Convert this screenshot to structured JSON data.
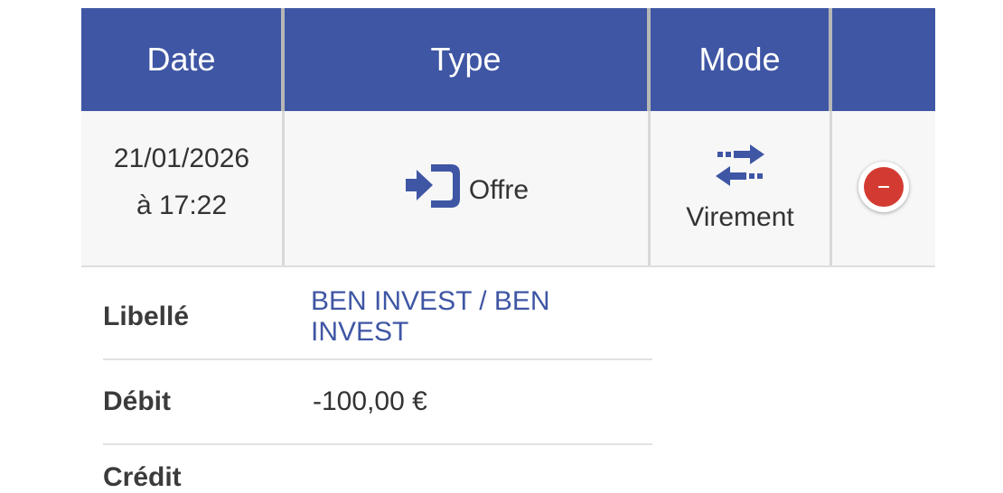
{
  "table": {
    "headers": [
      "Date",
      "Type",
      "Mode",
      ""
    ],
    "row": {
      "date_line1": "21/01/2026",
      "date_line2": "à 17:22",
      "type_label": "Offre",
      "type_icon": "sign-in-icon",
      "mode_label": "Virement",
      "mode_icon": "transfer-arrows-icon",
      "action_icon": "remove-icon"
    }
  },
  "details": [
    {
      "label": "Libellé",
      "value": "BEN INVEST / BEN INVEST"
    },
    {
      "label": "Débit",
      "value": "-100,00 €"
    }
  ],
  "partial_label": "Crédit",
  "colors": {
    "header_bg": "#3f56a4",
    "link": "#3f56a4",
    "remove_red": "#d33b32"
  }
}
